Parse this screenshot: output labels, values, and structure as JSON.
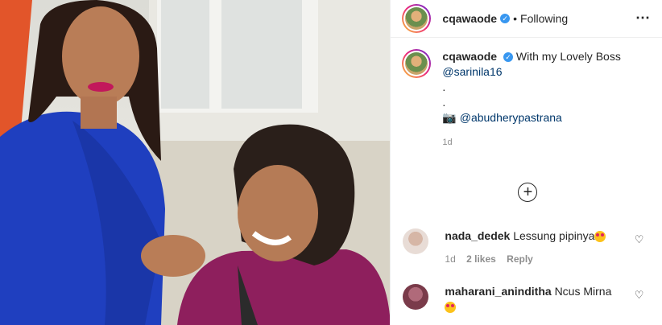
{
  "header": {
    "username": "cqawaode",
    "verified_mark": "✓",
    "separator": "•",
    "follow_status": "Following",
    "more_icon": "⋯"
  },
  "caption": {
    "username": "cqawaode",
    "text": "With my Lovely Boss",
    "mention": "@sarinila16",
    "line_dot_1": ".",
    "line_dot_2": ".",
    "camera_icon": "camera-icon",
    "credit": "@abudherypastrana",
    "time": "1d"
  },
  "add_icon": "+",
  "comments": [
    {
      "username": "nada_dedek",
      "text": "Lessung pipinya",
      "time": "1d",
      "likes": "2 likes",
      "reply": "Reply"
    },
    {
      "username": "maharani_aninditha",
      "text": "Ncus Mirna"
    }
  ],
  "heart_icon": "♡",
  "colors": {
    "link": "#00376b",
    "verified": "#3897f0",
    "shirt_blue": "#1f3fbf",
    "shirt_magenta": "#8e1f5d"
  }
}
